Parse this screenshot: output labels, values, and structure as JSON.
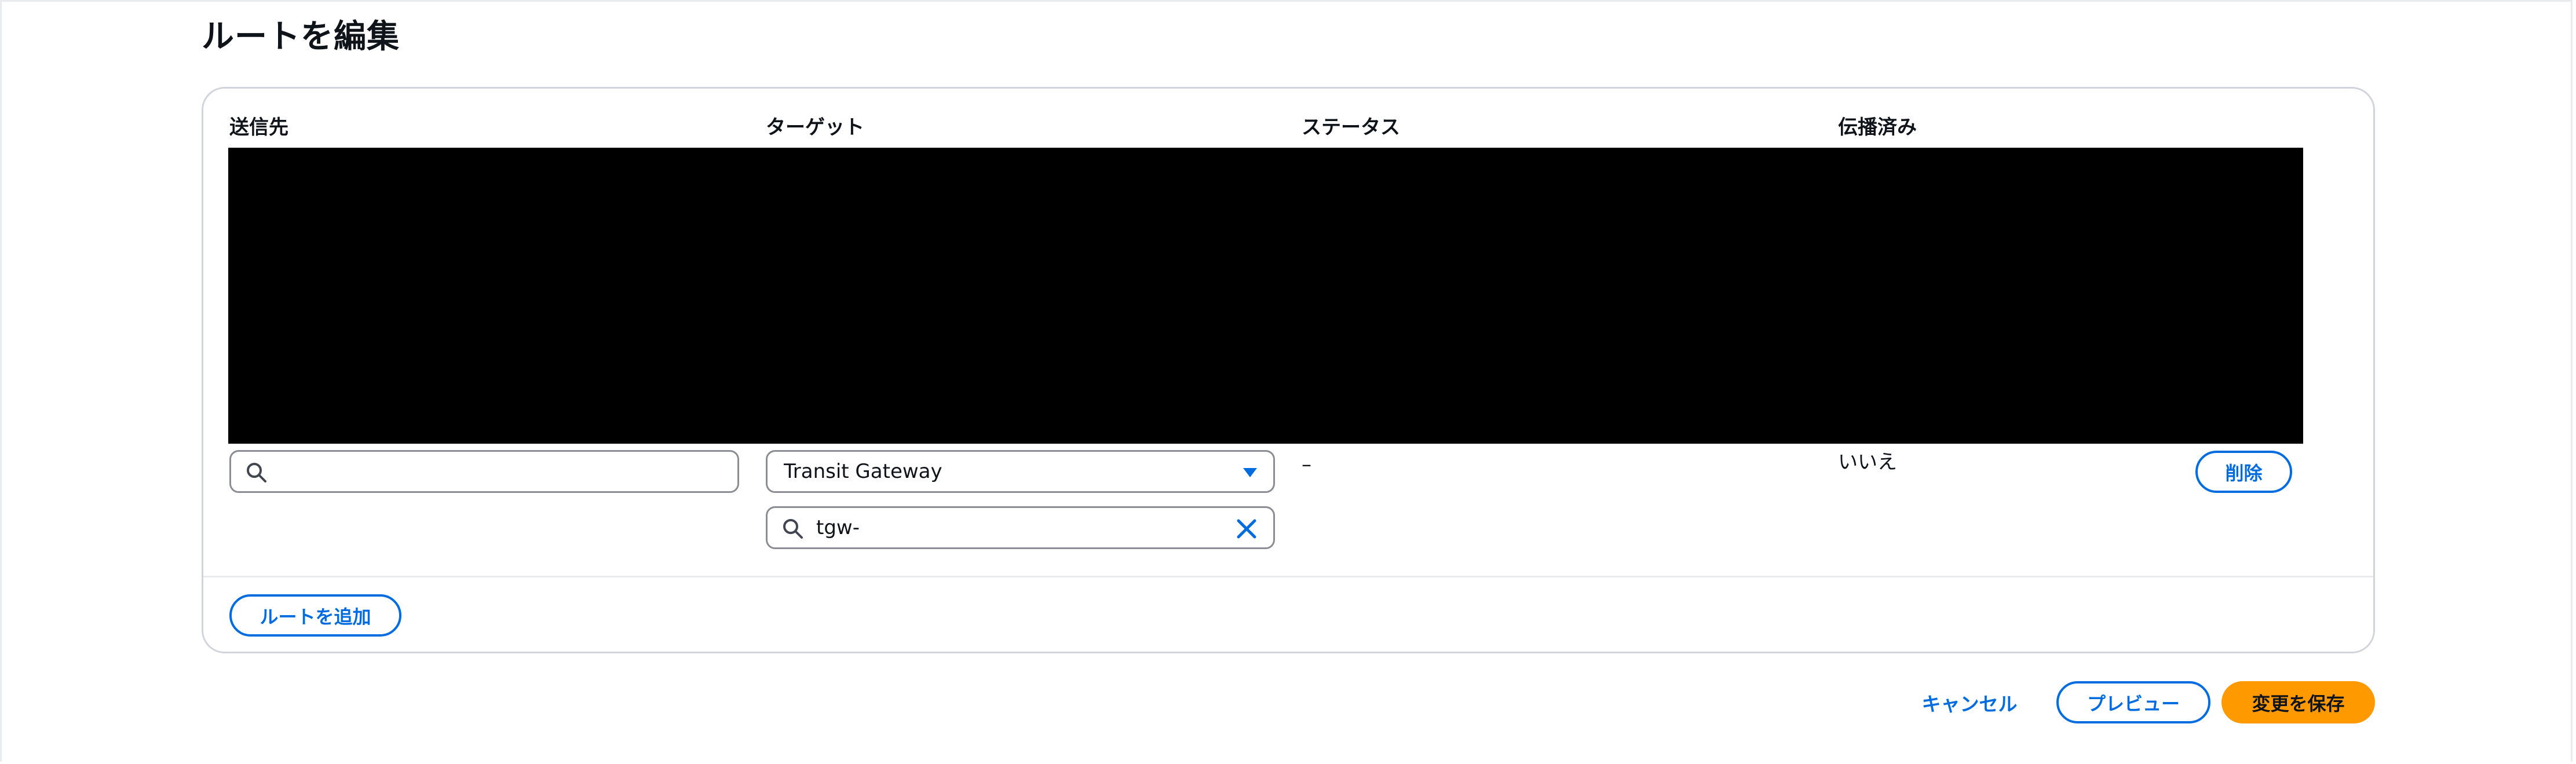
{
  "page": {
    "title": "ルートを編集"
  },
  "table": {
    "headers": {
      "destination": "送信先",
      "target": "ターゲット",
      "status": "ステータス",
      "propagated": "伝播済み"
    },
    "row": {
      "destination_value": "",
      "target_type": "Transit Gateway",
      "target_search_value": "tgw-",
      "status": "–",
      "propagated": "いいえ",
      "remove_label": "削除"
    }
  },
  "actions": {
    "add_route_label": "ルートを追加",
    "cancel_label": "キャンセル",
    "preview_label": "プレビュー",
    "save_label": "変更を保存"
  },
  "colors": {
    "accent": "#006ce0",
    "primary_button": "#ff9900",
    "text": "#0f141a",
    "border": "#8c8c94"
  }
}
